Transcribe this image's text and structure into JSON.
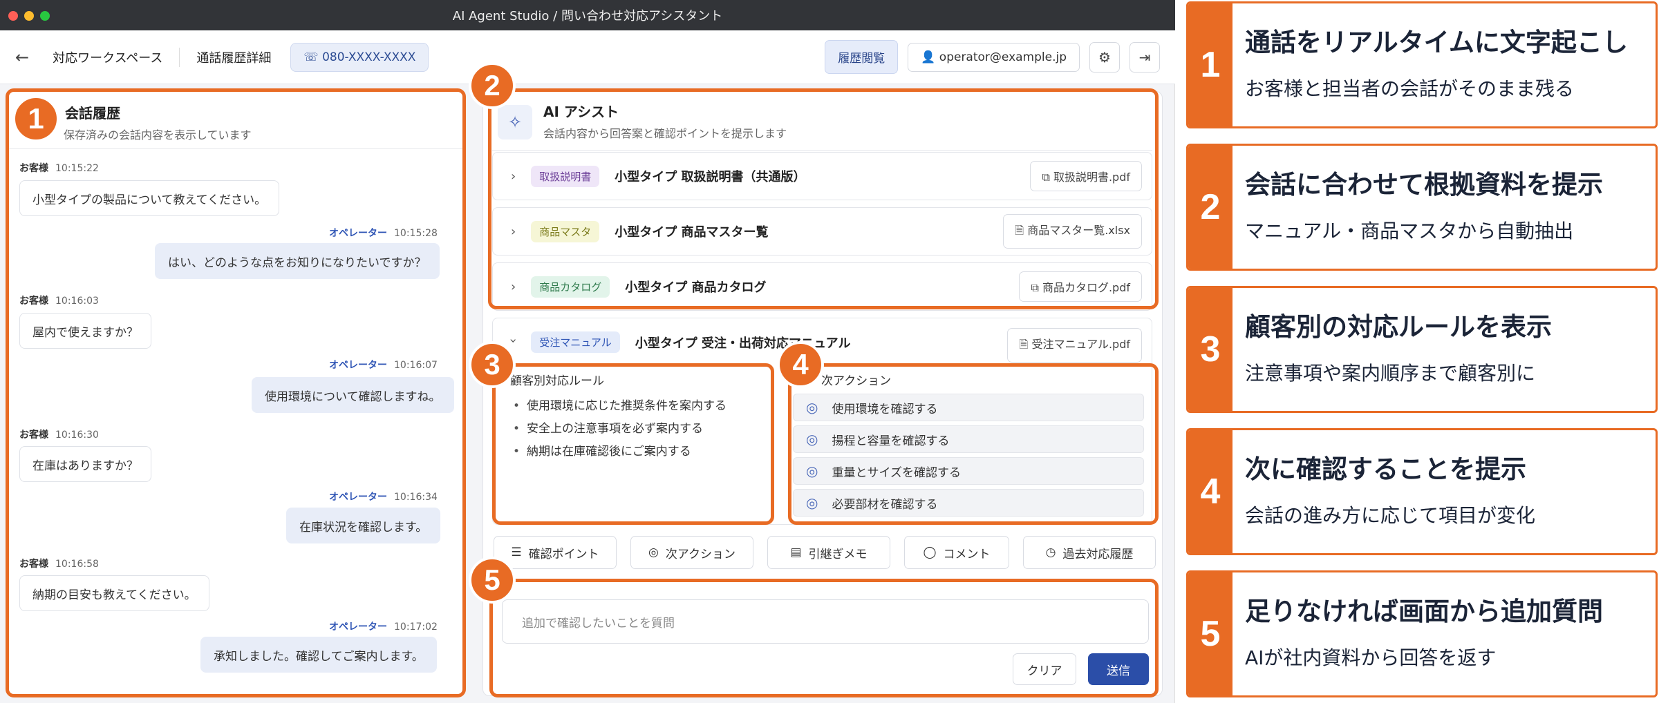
{
  "window": {
    "title": "AI Agent Studio / 問い合わせ対応アシスタント"
  },
  "topbar": {
    "breadcrumb1": "対応ワークスペース",
    "breadcrumb2": "通話履歴詳細",
    "phone": "080-XXXX-XXXX",
    "history_button": "履歴閲覧",
    "user": "operator@example.jp"
  },
  "history": {
    "title": "会話履歴",
    "subtitle": "保存済みの会話内容を表示しています",
    "messages": [
      {
        "who": "お客様",
        "time": "10:15:22",
        "text": "小型タイプの製品について教えてください。"
      },
      {
        "who": "オペレーター",
        "time": "10:15:28",
        "text": "はい、どのような点をお知りになりたいですか？"
      },
      {
        "who": "お客様",
        "time": "10:16:03",
        "text": "屋内で使えますか？"
      },
      {
        "who": "オペレーター",
        "time": "10:16:07",
        "text": "使用環境について確認しますね。"
      },
      {
        "who": "お客様",
        "time": "10:16:30",
        "text": "在庫はありますか？"
      },
      {
        "who": "オペレーター",
        "time": "10:16:34",
        "text": "在庫状況を確認します。"
      },
      {
        "who": "お客様",
        "time": "10:16:58",
        "text": "納期の目安も教えてください。"
      },
      {
        "who": "オペレーター",
        "time": "10:17:02",
        "text": "承知しました。確認してご案内します。"
      }
    ]
  },
  "assist": {
    "title": "AI アシスト",
    "subtitle": "会話内容から回答案と確認ポイントを提示します",
    "docs": [
      {
        "tag": "取扱説明書",
        "title": "小型タイプ 取扱説明書（共通版）",
        "file": "取扱説明書.pdf",
        "tag_bg": "#efe6f8",
        "tag_color": "#6a3c96"
      },
      {
        "tag": "商品マスタ",
        "title": "小型タイプ 商品マスター覧",
        "file": "商品マスター覧.xlsx",
        "tag_bg": "#f6f6d6",
        "tag_color": "#7a7a1a"
      },
      {
        "tag": "商品カタログ",
        "title": "小型タイプ 商品カタログ",
        "file": "商品カタログ.pdf",
        "tag_bg": "#e2f4ea",
        "tag_color": "#2f7a4c"
      },
      {
        "tag": "受注マニュアル",
        "title": "小型タイプ 受注・出荷対応マニュアル",
        "file": "受注マニュアル.pdf",
        "tag_bg": "#e4ebfa",
        "tag_color": "#2f55b5"
      }
    ],
    "rules_label": "顧客別対応ルール",
    "rules": [
      "使用環境に応じた推奨条件を案内する",
      "安全上の注意事項を必ず案内する",
      "納期は在庫確認後にご案内する"
    ],
    "actions_label": "次アクション",
    "actions": [
      "使用環境を確認する",
      "揚程と容量を確認する",
      "重量とサイズを確認する",
      "必要部材を確認する"
    ]
  },
  "tabs": [
    "確認ポイント",
    "次アクション",
    "引継ぎメモ",
    "コメント",
    "過去対応履歴"
  ],
  "query": {
    "placeholder": "追加で確認したいことを質問",
    "clear": "クリア",
    "send": "送信"
  },
  "badges": [
    "1",
    "2",
    "3",
    "4",
    "5"
  ],
  "cards": [
    {
      "num": "1",
      "title": "通話をリアルタイムに文字起こし",
      "sub": "お客様と担当者の会話がそのまま残る"
    },
    {
      "num": "2",
      "title": "会話に合わせて根拠資料を提示",
      "sub": "マニュアル・商品マスタから自動抽出"
    },
    {
      "num": "3",
      "title": "顧客別の対応ルールを表示",
      "sub": "注意事項や案内順序まで顧客別に"
    },
    {
      "num": "4",
      "title": "次に確認することを提示",
      "sub": "会話の進み方に応じて項目が変化"
    },
    {
      "num": "5",
      "title": "足りなければ画面から追加質問",
      "sub": "AIが社内資料から回答を返す"
    }
  ],
  "colors": {
    "accent": "#e86b24",
    "primary": "#2b4ea8"
  }
}
